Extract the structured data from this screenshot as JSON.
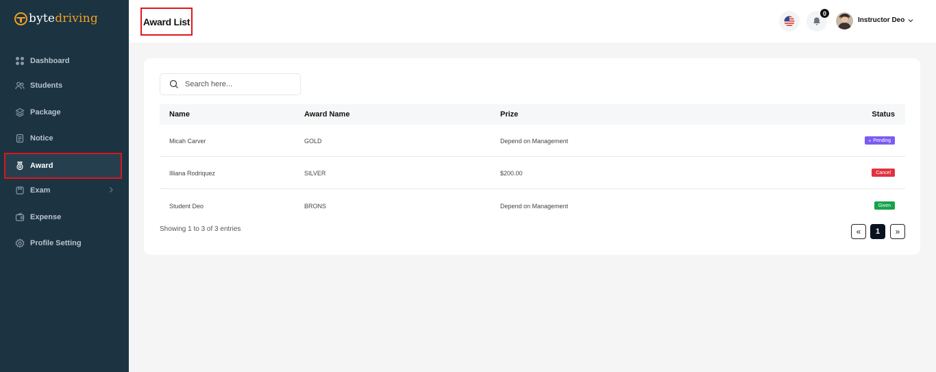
{
  "app": {
    "logo_part1": "byte",
    "logo_part2": "driving"
  },
  "sidebar": {
    "items": [
      {
        "label": "Dashboard",
        "icon": "grid-icon"
      },
      {
        "label": "Students",
        "icon": "users-icon"
      },
      {
        "label": "Package",
        "icon": "layers-icon"
      },
      {
        "label": "Notice",
        "icon": "document-icon"
      },
      {
        "label": "Award",
        "icon": "award-icon",
        "active": true
      },
      {
        "label": "Exam",
        "icon": "exam-icon",
        "has_submenu": true
      },
      {
        "label": "Expense",
        "icon": "wallet-icon"
      },
      {
        "label": "Profile Setting",
        "icon": "gear-icon"
      }
    ]
  },
  "header": {
    "title": "Award List",
    "notification_count": "0",
    "user_name": "Instructor Deo",
    "language_icon": "us-flag-icon"
  },
  "search": {
    "placeholder": "Search here..."
  },
  "table": {
    "headers": {
      "name": "Name",
      "award": "Award Name",
      "prize": "Prize",
      "status": "Status"
    },
    "rows": [
      {
        "name": "Micah Carver",
        "award": "GOLD",
        "prize": "Depend on Management",
        "status": "Pending"
      },
      {
        "name": "Illiana Rodriquez",
        "award": "SILVER",
        "prize": "$200.00",
        "status": "Cancel"
      },
      {
        "name": "Student Deo",
        "award": "BRONS",
        "prize": "Depend on Management",
        "status": "Given"
      }
    ]
  },
  "pagination": {
    "info": "Showing 1 to 3 of 3 entries",
    "prev": "«",
    "current": "1",
    "next": "»"
  },
  "colors": {
    "sidebar_bg": "#1c3342",
    "accent": "#f0a024",
    "highlight_border": "#e0141c",
    "pending": "#7c5cf3",
    "cancel": "#e0323f",
    "given": "#16a34a"
  }
}
